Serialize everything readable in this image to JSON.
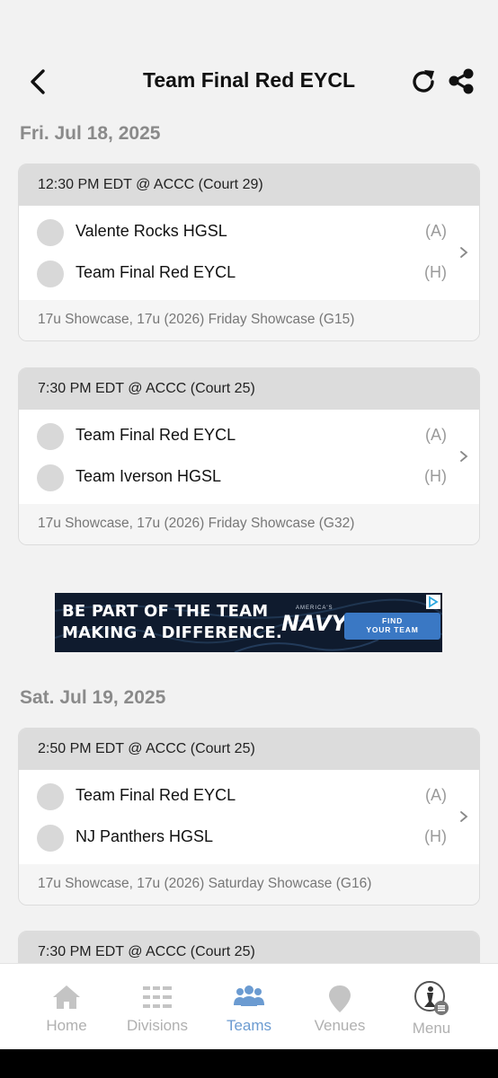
{
  "header": {
    "title": "Team Final Red EYCL",
    "back_icon": "chevron-left-icon",
    "refresh_icon": "refresh-icon",
    "share_icon": "share-icon"
  },
  "days": [
    {
      "date": "Fri. Jul 18, 2025",
      "games": [
        {
          "header": "12:30 PM EDT @ ACCC (Court 29)",
          "team1": {
            "name": "Valente Rocks HGSL",
            "side": "(A)"
          },
          "team2": {
            "name": "Team Final Red EYCL",
            "side": "(H)"
          },
          "footer": "17u Showcase, 17u (2026) Friday Showcase (G15)"
        },
        {
          "header": "7:30 PM EDT @ ACCC (Court 25)",
          "team1": {
            "name": "Team Final Red EYCL",
            "side": "(A)"
          },
          "team2": {
            "name": "Team Iverson HGSL",
            "side": "(H)"
          },
          "footer": "17u Showcase, 17u (2026) Friday Showcase (G32)"
        }
      ]
    },
    {
      "date": "Sat. Jul 19, 2025",
      "games": [
        {
          "header": "2:50 PM EDT @ ACCC (Court 25)",
          "team1": {
            "name": "Team Final Red EYCL",
            "side": "(A)"
          },
          "team2": {
            "name": "NJ Panthers HGSL",
            "side": "(H)"
          },
          "footer": "17u Showcase, 17u (2026) Saturday Showcase (G16)"
        },
        {
          "header": "7:30 PM EDT @ ACCC (Court 25)"
        }
      ]
    }
  ],
  "ad": {
    "line1": "BE PART OF THE TEAM",
    "line2": "MAKING A DIFFERENCE.",
    "brand_small": "AMERICA'S",
    "brand": "NAVY",
    "cta_line1": "FIND",
    "cta_line2": "YOUR TEAM"
  },
  "tabs": [
    {
      "label": "Home",
      "icon": "home-icon",
      "active": false
    },
    {
      "label": "Divisions",
      "icon": "list-icon",
      "active": false
    },
    {
      "label": "Teams",
      "icon": "people-icon",
      "active": true
    },
    {
      "label": "Venues",
      "icon": "location-pin-icon",
      "active": false
    },
    {
      "label": "Menu",
      "icon": "menu-avatar-icon",
      "active": false
    }
  ],
  "colors": {
    "accent": "#6b9bd1",
    "card_header": "#dcdcdc",
    "date_heading": "#8a8a8a",
    "inactive_tab": "#b0b0b0"
  }
}
